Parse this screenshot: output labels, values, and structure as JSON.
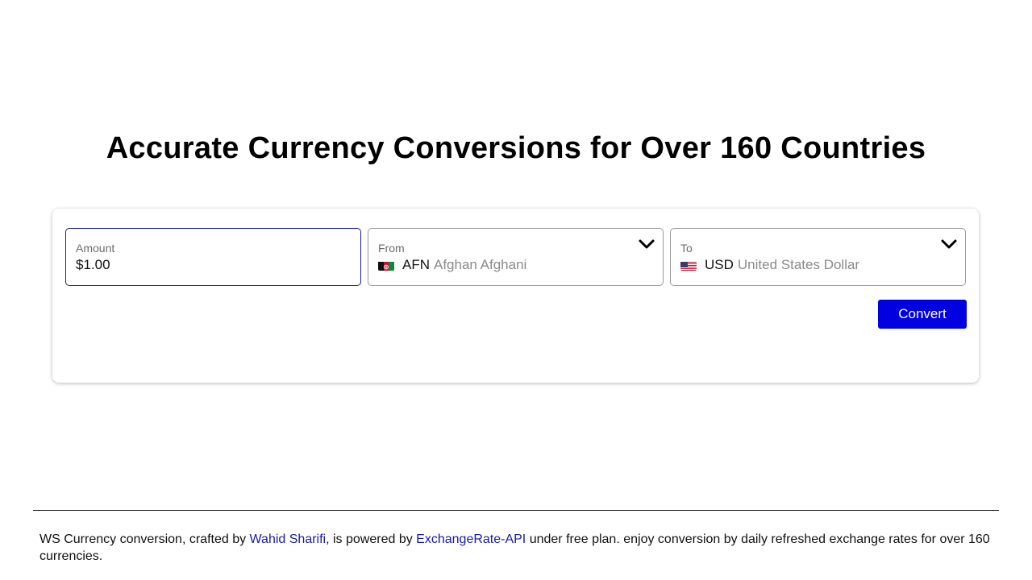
{
  "heading": "Accurate Currency Conversions for Over 160 Countries",
  "converter": {
    "amount": {
      "label": "Amount",
      "value": "$1.00"
    },
    "from": {
      "label": "From",
      "code": "AFN",
      "name": "Afghan Afghani",
      "flag_icon": "afghanistan-flag-icon"
    },
    "to": {
      "label": "To",
      "code": "USD",
      "name": "United States Dollar",
      "flag_icon": "united-states-flag-icon"
    },
    "convert_label": "Convert"
  },
  "footer": {
    "text_1": "WS Currency conversion, crafted by ",
    "author_link": "Wahid Sharifi",
    "text_2": ", is powered by ",
    "api_link": "ExchangeRate-API",
    "text_3": " under free plan. enjoy conversion by daily refreshed exchange rates for over 160 currencies."
  },
  "colors": {
    "accent": "#0000e0",
    "link": "#1a1aa8",
    "active_border": "#1a1a9a"
  }
}
